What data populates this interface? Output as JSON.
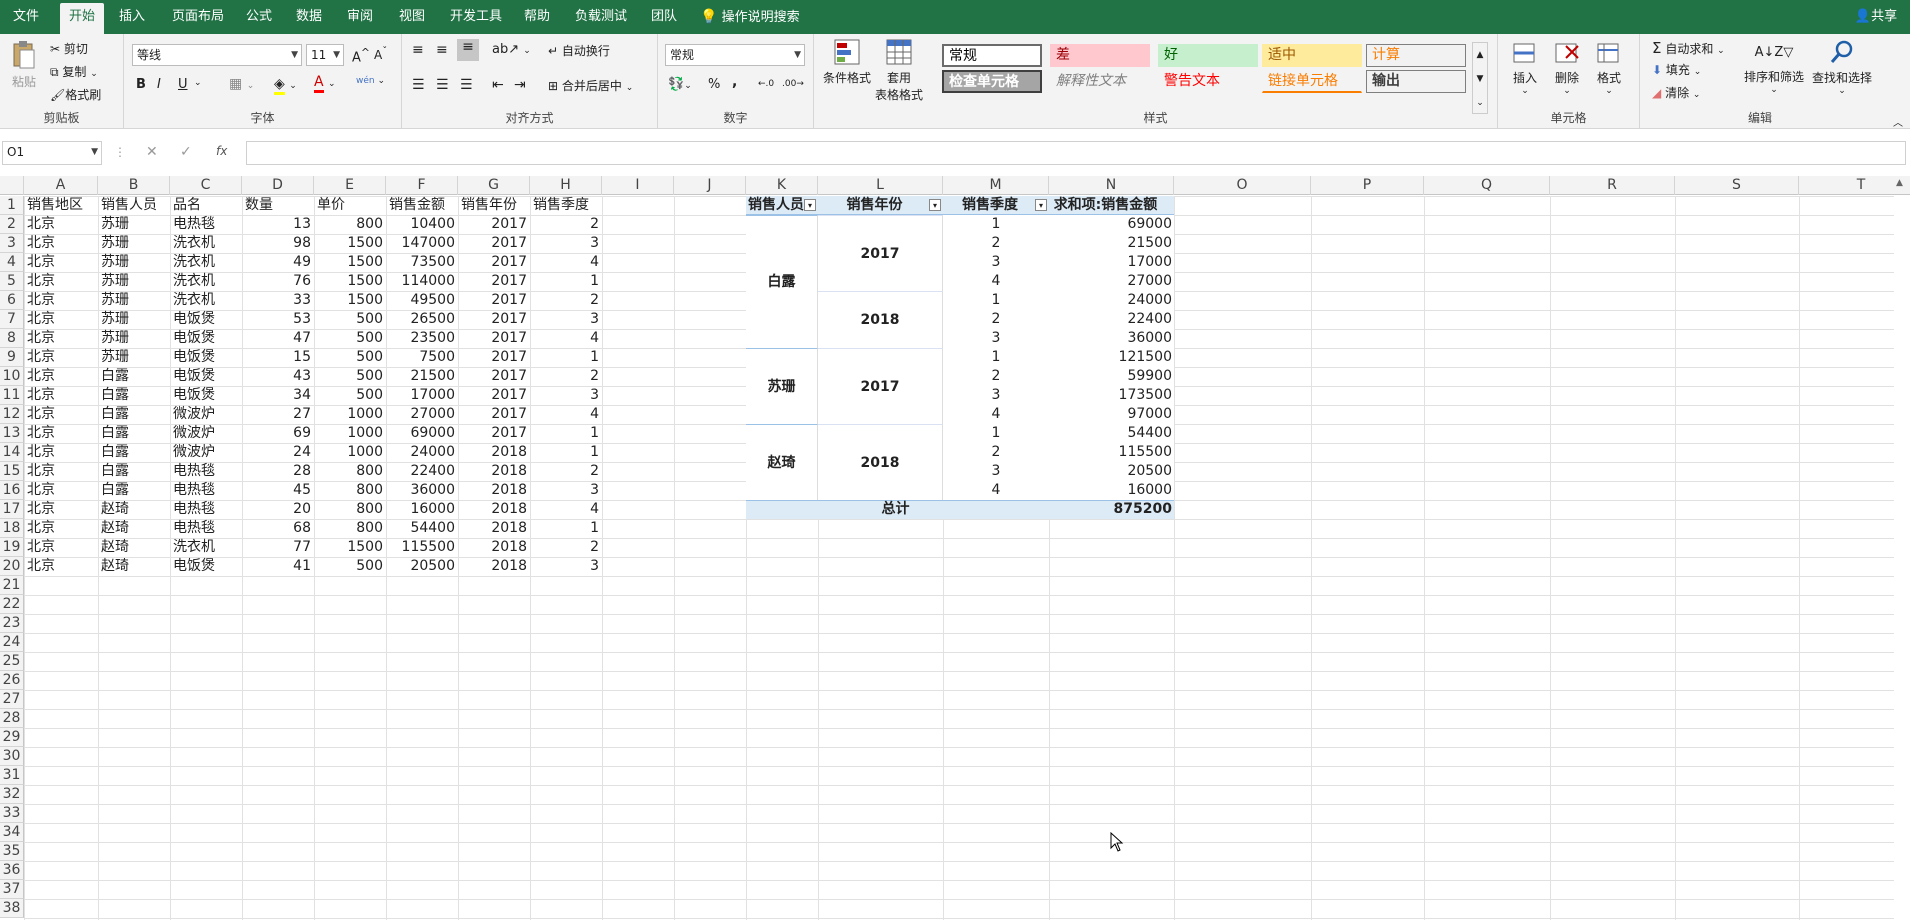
{
  "tabs": [
    "文件",
    "开始",
    "插入",
    "页面布局",
    "公式",
    "数据",
    "审阅",
    "视图",
    "开发工具",
    "帮助",
    "负载测试",
    "团队"
  ],
  "tell_me": "操作说明搜索",
  "share": "共享",
  "ribbon": {
    "clipboard": {
      "label": "剪贴板",
      "paste": "粘贴",
      "cut": "剪切",
      "copy": "复制",
      "format_painter": "格式刷"
    },
    "font": {
      "label": "字体",
      "name": "等线",
      "size": "11",
      "bold": "B",
      "italic": "I",
      "underline": "U",
      "color_a": "A",
      "phonetic": "wén"
    },
    "alignment": {
      "label": "对齐方式",
      "wrap": "自动换行",
      "merge": "合并后居中"
    },
    "number": {
      "label": "数字",
      "format": "常规",
      "percent": "%",
      "comma": ","
    },
    "styles": {
      "label": "样式",
      "cond": "条件格式",
      "table": "套用",
      "table2": "表格格式",
      "items": [
        {
          "text": "常规",
          "bg": "#ffffff",
          "color": "#000000"
        },
        {
          "text": "差",
          "bg": "#ffc7ce",
          "color": "#9c0006"
        },
        {
          "text": "好",
          "bg": "#c6efce",
          "color": "#006100"
        },
        {
          "text": "适中",
          "bg": "#ffeb9c",
          "color": "#9c5700"
        },
        {
          "text": "计算",
          "bg": "#f2f2f2",
          "color": "#fa7d00"
        },
        {
          "text": "检查单元格",
          "bg": "#a5a5a5",
          "color": "#ffffff"
        },
        {
          "text": "解释性文本",
          "bg": "#f3f3f3",
          "color": "#7f7f7f"
        },
        {
          "text": "警告文本",
          "bg": "#f3f3f3",
          "color": "#ff0000"
        },
        {
          "text": "链接单元格",
          "bg": "#f3f3f3",
          "color": "#fa7d00"
        },
        {
          "text": "输出",
          "bg": "#f2f2f2",
          "color": "#3f3f3f"
        }
      ]
    },
    "cells": {
      "label": "单元格",
      "insert": "插入",
      "delete": "删除",
      "format": "格式"
    },
    "editing": {
      "label": "编辑",
      "autosum": "自动求和",
      "fill": "填充",
      "clear": "清除",
      "sort": "排序和筛选",
      "find": "查找和选择"
    }
  },
  "formula_bar": {
    "name_box": "O1",
    "fx": "fx",
    "value": ""
  },
  "columns": [
    "A",
    "B",
    "C",
    "D",
    "E",
    "F",
    "G",
    "H",
    "I",
    "J",
    "K",
    "L",
    "M",
    "N",
    "O",
    "P",
    "Q",
    "R",
    "S",
    "T"
  ],
  "rows": [
    "1",
    "2",
    "3",
    "4",
    "5",
    "6",
    "7",
    "8",
    "9",
    "10",
    "11",
    "12",
    "13",
    "14",
    "15",
    "16",
    "17",
    "18",
    "19",
    "20",
    "21",
    "22",
    "23",
    "24",
    "25",
    "26",
    "27",
    "28",
    "29",
    "30",
    "31",
    "32",
    "33",
    "34",
    "35",
    "36",
    "37",
    "38"
  ],
  "sheet": {
    "headers": [
      "销售地区",
      "销售人员",
      "品名",
      "数量",
      "单价",
      "销售金额",
      "销售年份",
      "销售季度"
    ],
    "data": [
      [
        "北京",
        "苏珊",
        "电热毯",
        "13",
        "800",
        "10400",
        "2017",
        "2"
      ],
      [
        "北京",
        "苏珊",
        "洗衣机",
        "98",
        "1500",
        "147000",
        "2017",
        "3"
      ],
      [
        "北京",
        "苏珊",
        "洗衣机",
        "49",
        "1500",
        "73500",
        "2017",
        "4"
      ],
      [
        "北京",
        "苏珊",
        "洗衣机",
        "76",
        "1500",
        "114000",
        "2017",
        "1"
      ],
      [
        "北京",
        "苏珊",
        "洗衣机",
        "33",
        "1500",
        "49500",
        "2017",
        "2"
      ],
      [
        "北京",
        "苏珊",
        "电饭煲",
        "53",
        "500",
        "26500",
        "2017",
        "3"
      ],
      [
        "北京",
        "苏珊",
        "电饭煲",
        "47",
        "500",
        "23500",
        "2017",
        "4"
      ],
      [
        "北京",
        "苏珊",
        "电饭煲",
        "15",
        "500",
        "7500",
        "2017",
        "1"
      ],
      [
        "北京",
        "白露",
        "电饭煲",
        "43",
        "500",
        "21500",
        "2017",
        "2"
      ],
      [
        "北京",
        "白露",
        "电饭煲",
        "34",
        "500",
        "17000",
        "2017",
        "3"
      ],
      [
        "北京",
        "白露",
        "微波炉",
        "27",
        "1000",
        "27000",
        "2017",
        "4"
      ],
      [
        "北京",
        "白露",
        "微波炉",
        "69",
        "1000",
        "69000",
        "2017",
        "1"
      ],
      [
        "北京",
        "白露",
        "微波炉",
        "24",
        "1000",
        "24000",
        "2018",
        "1"
      ],
      [
        "北京",
        "白露",
        "电热毯",
        "28",
        "800",
        "22400",
        "2018",
        "2"
      ],
      [
        "北京",
        "白露",
        "电热毯",
        "45",
        "800",
        "36000",
        "2018",
        "3"
      ],
      [
        "北京",
        "赵琦",
        "电热毯",
        "20",
        "800",
        "16000",
        "2018",
        "4"
      ],
      [
        "北京",
        "赵琦",
        "电热毯",
        "68",
        "800",
        "54400",
        "2018",
        "1"
      ],
      [
        "北京",
        "赵琦",
        "洗衣机",
        "77",
        "1500",
        "115500",
        "2018",
        "2"
      ],
      [
        "北京",
        "赵琦",
        "电饭煲",
        "41",
        "500",
        "20500",
        "2018",
        "3"
      ]
    ]
  },
  "pivot": {
    "headers": [
      "销售人员",
      "销售年份",
      "销售季度",
      "求和项:销售金额"
    ],
    "persons": [
      "白露",
      "苏珊",
      "赵琦"
    ],
    "years": [
      "2017",
      "2018",
      "2017",
      "2018"
    ],
    "quarters": [
      "1",
      "2",
      "3",
      "4",
      "1",
      "2",
      "3",
      "1",
      "2",
      "3",
      "4",
      "1",
      "2",
      "3",
      "4"
    ],
    "values": [
      "69000",
      "21500",
      "17000",
      "27000",
      "24000",
      "22400",
      "36000",
      "121500",
      "59900",
      "173500",
      "97000",
      "54400",
      "115500",
      "20500",
      "16000"
    ],
    "total_label": "总计",
    "total_value": "875200"
  }
}
